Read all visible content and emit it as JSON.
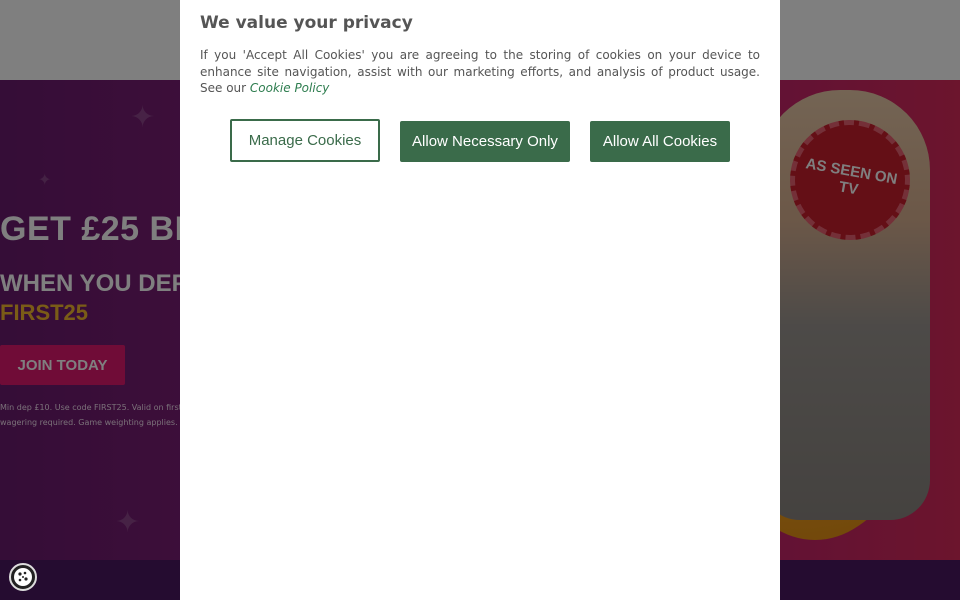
{
  "background_page": {
    "hero_title": "GET £25 BI",
    "hero_subtitle": "WHEN YOU DEP",
    "promo_code": "FIRST25",
    "join_button": "JOIN TODAY",
    "terms_line1": "Min dep £10. Use code FIRST25. Valid on first",
    "terms_line2": "wagering required. Game weighting applies. 5-",
    "seal_text": "AS SEEN ON TV"
  },
  "cookie_modal": {
    "title": "We value your privacy",
    "body": "If you 'Accept All Cookies' you are agreeing to the storing of cookies on your device to enhance site navigation, assist with our marketing efforts, and analysis of product usage. See our",
    "policy_link": "Cookie Policy",
    "buttons": {
      "manage": "Manage Cookies",
      "necessary": "Allow Necessary Only",
      "all": "Allow All Cookies"
    }
  },
  "colors": {
    "accent_green": "#3a6b4a",
    "link_green": "#2e7d4f",
    "promo_gold": "#f5b82e",
    "join_pink": "#e0186e"
  },
  "icons": {
    "cookie_settings": "cookie-icon"
  }
}
